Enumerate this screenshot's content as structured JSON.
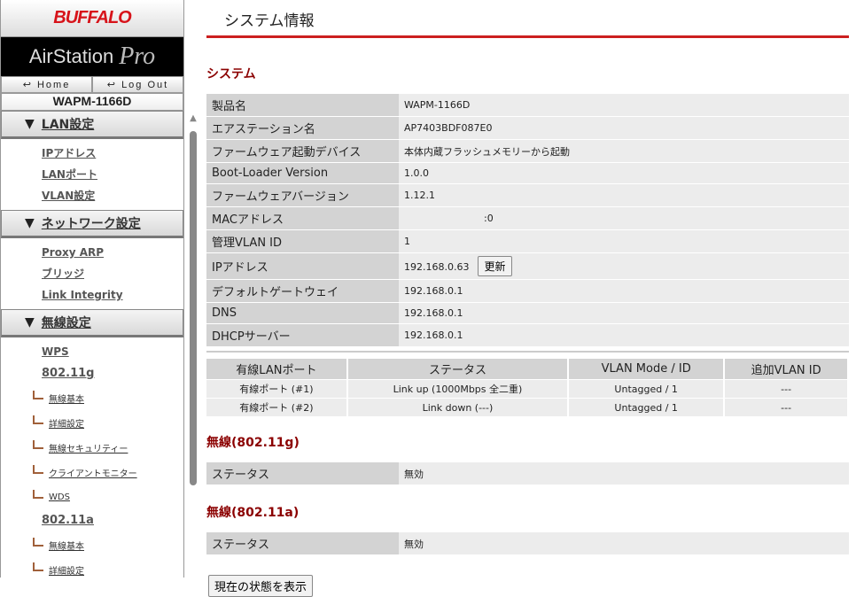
{
  "sidebar": {
    "brand": "BUFFALO",
    "product": "AirStation",
    "product_suffix": "Pro",
    "home": "Home",
    "logout": "Log Out",
    "model": "WAPM-1166D",
    "sections": [
      {
        "label": "LAN設定",
        "items": [
          "IPアドレス",
          "LANポート",
          "VLAN設定"
        ]
      },
      {
        "label": "ネットワーク設定",
        "items": [
          "Proxy ARP",
          "ブリッジ",
          "Link Integrity"
        ]
      },
      {
        "label": "無線設定",
        "items": [
          "WPS"
        ]
      }
    ],
    "g": {
      "label": "802.11g",
      "subs": [
        "無線基本",
        "詳細設定",
        "無線セキュリティー",
        "クライアントモニター",
        "WDS"
      ]
    },
    "a": {
      "label": "802.11a",
      "subs": [
        "無線基本",
        "詳細設定"
      ]
    }
  },
  "main": {
    "title": "システム情報",
    "system_heading": "システム",
    "rows": [
      [
        "製品名",
        "WAPM-1166D"
      ],
      [
        "エアステーション名",
        "AP7403BDF087E0"
      ],
      [
        "ファームウェア起動デバイス",
        "本体内蔵フラッシュメモリーから起動"
      ],
      [
        "Boot-Loader Version",
        "1.0.0"
      ],
      [
        "ファームウェアバージョン",
        "1.12.1"
      ],
      [
        "MACアドレス",
        ":0"
      ],
      [
        "管理VLAN ID",
        "1"
      ],
      [
        "IPアドレス",
        "192.168.0.63"
      ],
      [
        "デフォルトゲートウェイ",
        "192.168.0.1"
      ],
      [
        "DNS",
        "192.168.0.1"
      ],
      [
        "DHCPサーバー",
        "192.168.0.1"
      ]
    ],
    "refresh": "更新",
    "ports": {
      "headers": [
        "有線LANポート",
        "ステータス",
        "VLAN Mode / ID",
        "追加VLAN ID"
      ],
      "rows": [
        [
          "有線ポート (#1)",
          "Link up (1000Mbps 全二重)",
          "Untagged  /  1",
          "---"
        ],
        [
          "有線ポート (#2)",
          "Link down (---)",
          "Untagged  /  1",
          "---"
        ]
      ]
    },
    "wg_heading": "無線(802.11g)",
    "wa_heading": "無線(802.11a)",
    "status_label": "ステータス",
    "wg_status": "無効",
    "wa_status": "無効",
    "show_button": "現在の状態を表示"
  }
}
